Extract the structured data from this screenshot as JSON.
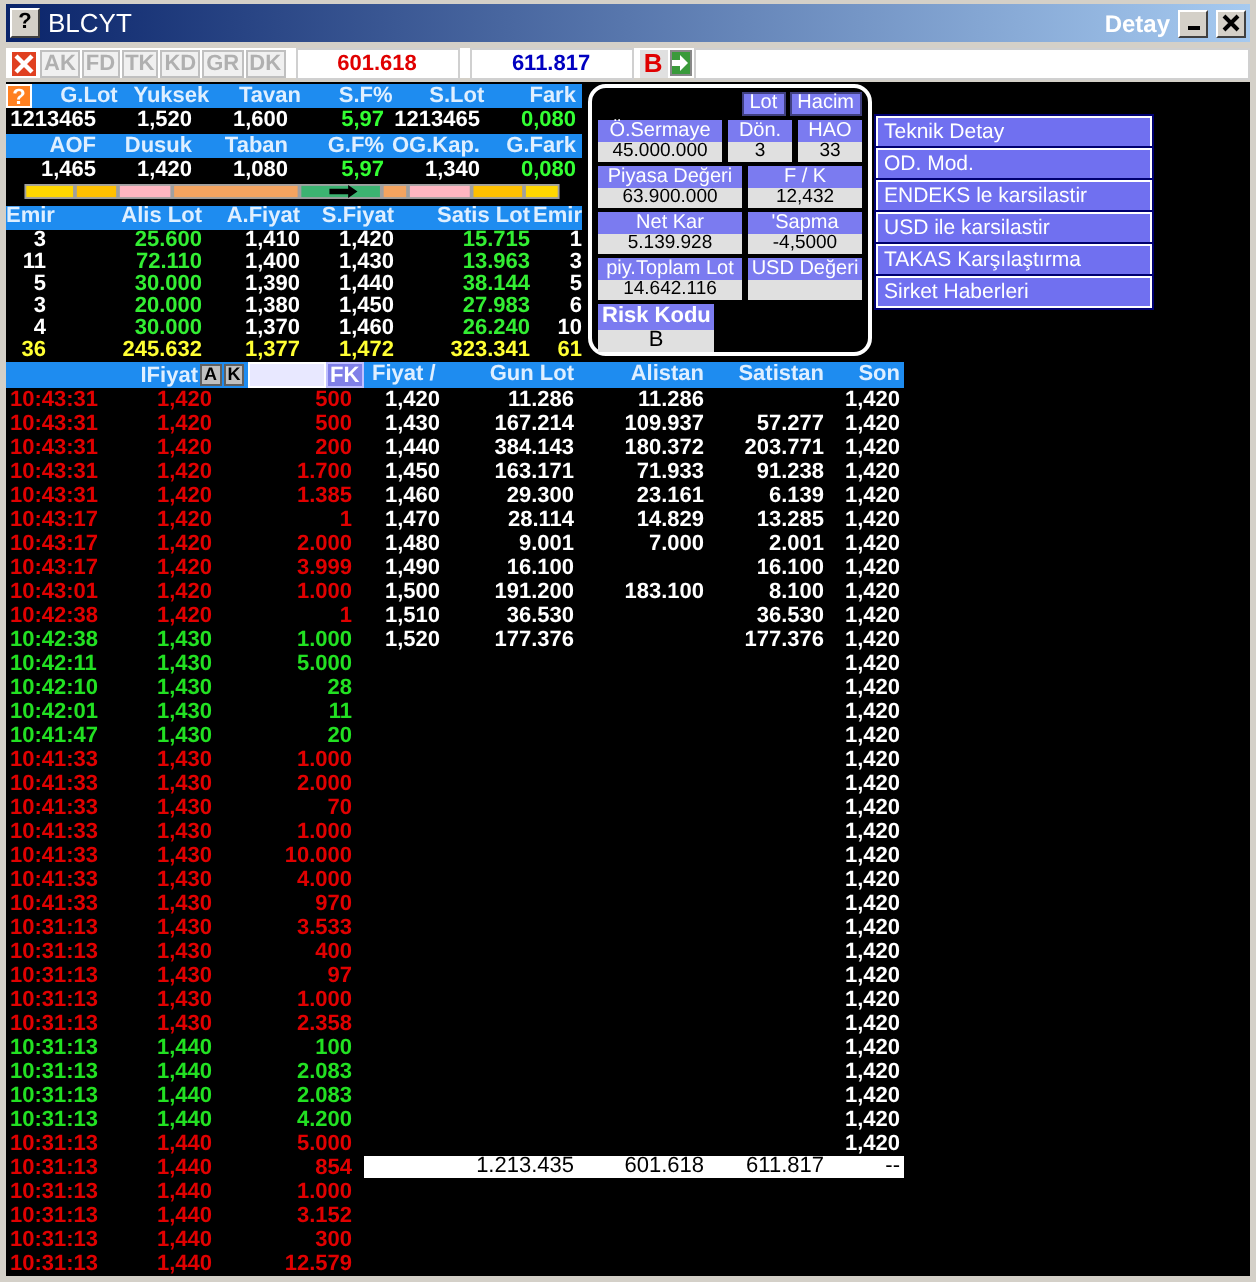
{
  "window": {
    "help": "?",
    "title": "BLCYT",
    "subtitle": "Detay"
  },
  "summary_help": "?",
  "toolbar": {
    "tabs": [
      {
        "label": "AK",
        "disabled": true
      },
      {
        "label": "FD",
        "disabled": true
      },
      {
        "label": "TK",
        "disabled": true
      },
      {
        "label": "KD",
        "disabled": true
      },
      {
        "label": "GR",
        "disabled": true
      },
      {
        "label": "DK",
        "disabled": true
      }
    ],
    "values": [
      {
        "text": "601.618",
        "color": "#e00000"
      },
      {
        "text": "611.817",
        "color": "#0000c0"
      }
    ],
    "b_button": "B"
  },
  "summary": [
    {
      "labels": [
        "G.Lot",
        "Yuksek",
        "Tavan",
        "S.F%",
        "S.Lot",
        "Fark"
      ],
      "values": [
        {
          "text": "1213465",
          "kind": "plain"
        },
        {
          "text": "1,520",
          "kind": "plain"
        },
        {
          "text": "1,600",
          "kind": "plain"
        },
        {
          "text": "5,97",
          "kind": "change"
        },
        {
          "text": "1213465",
          "kind": "plain"
        },
        {
          "text": "0,080",
          "kind": "change"
        }
      ]
    },
    {
      "labels": [
        "AOF",
        "Dusuk",
        "Taban",
        "G.F%",
        "OG.Kap.",
        "G.Fark"
      ],
      "values": [
        {
          "text": "1,465",
          "kind": "plain"
        },
        {
          "text": "1,420",
          "kind": "plain"
        },
        {
          "text": "1,080",
          "kind": "plain"
        },
        {
          "text": "5,97",
          "kind": "change"
        },
        {
          "text": "1,340",
          "kind": "plain"
        },
        {
          "text": "0,080",
          "kind": "change"
        }
      ]
    }
  ],
  "order_book": {
    "columns": [
      "Emir",
      "Alis Lot",
      "A.Fiyat",
      "S.Fiyat",
      "Satis Lot",
      "Emir"
    ],
    "rows": [
      {
        "kind": "level",
        "cells": [
          "3",
          "25.600",
          "1,410",
          "1,420",
          "15.715",
          "1"
        ]
      },
      {
        "kind": "level",
        "cells": [
          "11",
          "72.110",
          "1,400",
          "1,430",
          "13.963",
          "3"
        ]
      },
      {
        "kind": "level",
        "cells": [
          "5",
          "30.000",
          "1,390",
          "1,440",
          "38.144",
          "5"
        ]
      },
      {
        "kind": "level",
        "cells": [
          "3",
          "20.000",
          "1,380",
          "1,450",
          "27.983",
          "6"
        ]
      },
      {
        "kind": "level",
        "cells": [
          "4",
          "30.000",
          "1,370",
          "1,460",
          "26.240",
          "10"
        ]
      },
      {
        "kind": "total",
        "cells": [
          "36",
          "245.632",
          "1,377",
          "1,472",
          "323.341",
          "61"
        ]
      }
    ]
  },
  "info": {
    "buttons": [
      "Lot",
      "Hacim"
    ],
    "rows": [
      [
        {
          "label": "Ö.Sermaye",
          "value": "45.000.000"
        },
        {
          "label": "Dön.",
          "value": "3"
        },
        {
          "label": "HAO",
          "value": "33"
        }
      ],
      [
        {
          "label": "Piyasa Değeri",
          "value": "63.900.000"
        },
        {
          "label": "F / K",
          "value": "12,432"
        }
      ],
      [
        {
          "label": "Net Kar",
          "value": "5.139.928"
        },
        {
          "label": "'Sapma",
          "value": "-4,5000"
        }
      ],
      [
        {
          "label": "piy.Toplam Lot",
          "value": "14.642.116"
        },
        {
          "label": "USD Değeri"
        }
      ]
    ],
    "risk": {
      "label": "Risk Kodu",
      "value": "B"
    }
  },
  "menu": [
    "Teknik Detay",
    "OD. Mod.",
    "ENDEKS le karsilastir",
    "USD ile karsilastir",
    "TAKAS Karşılaştırma",
    "Sirket Haberleri"
  ],
  "trades": {
    "header": "IFiyat",
    "buttons": [
      "A",
      "K"
    ],
    "filter_button": "FK",
    "rows": [
      {
        "time": "10:43:31",
        "price": "1,420",
        "lot": "500",
        "kind": "sell"
      },
      {
        "time": "10:43:31",
        "price": "1,420",
        "lot": "500",
        "kind": "sell"
      },
      {
        "time": "10:43:31",
        "price": "1,420",
        "lot": "200",
        "kind": "sell"
      },
      {
        "time": "10:43:31",
        "price": "1,420",
        "lot": "1.700",
        "kind": "sell"
      },
      {
        "time": "10:43:31",
        "price": "1,420",
        "lot": "1.385",
        "kind": "sell"
      },
      {
        "time": "10:43:17",
        "price": "1,420",
        "lot": "1",
        "kind": "sell"
      },
      {
        "time": "10:43:17",
        "price": "1,420",
        "lot": "2.000",
        "kind": "sell"
      },
      {
        "time": "10:43:17",
        "price": "1,420",
        "lot": "3.999",
        "kind": "sell"
      },
      {
        "time": "10:43:01",
        "price": "1,420",
        "lot": "1.000",
        "kind": "sell"
      },
      {
        "time": "10:42:38",
        "price": "1,420",
        "lot": "1",
        "kind": "sell"
      },
      {
        "time": "10:42:38",
        "price": "1,430",
        "lot": "1.000",
        "kind": "buy"
      },
      {
        "time": "10:42:11",
        "price": "1,430",
        "lot": "5.000",
        "kind": "buy"
      },
      {
        "time": "10:42:10",
        "price": "1,430",
        "lot": "28",
        "kind": "buy"
      },
      {
        "time": "10:42:01",
        "price": "1,430",
        "lot": "11",
        "kind": "buy"
      },
      {
        "time": "10:41:47",
        "price": "1,430",
        "lot": "20",
        "kind": "buy"
      },
      {
        "time": "10:41:33",
        "price": "1,430",
        "lot": "1.000",
        "kind": "sell"
      },
      {
        "time": "10:41:33",
        "price": "1,430",
        "lot": "2.000",
        "kind": "sell"
      },
      {
        "time": "10:41:33",
        "price": "1,430",
        "lot": "70",
        "kind": "sell"
      },
      {
        "time": "10:41:33",
        "price": "1,430",
        "lot": "1.000",
        "kind": "sell"
      },
      {
        "time": "10:41:33",
        "price": "1,430",
        "lot": "10.000",
        "kind": "sell"
      },
      {
        "time": "10:41:33",
        "price": "1,430",
        "lot": "4.000",
        "kind": "sell"
      },
      {
        "time": "10:41:33",
        "price": "1,430",
        "lot": "970",
        "kind": "sell"
      },
      {
        "time": "10:31:13",
        "price": "1,430",
        "lot": "3.533",
        "kind": "sell"
      },
      {
        "time": "10:31:13",
        "price": "1,430",
        "lot": "400",
        "kind": "sell"
      },
      {
        "time": "10:31:13",
        "price": "1,430",
        "lot": "97",
        "kind": "sell"
      },
      {
        "time": "10:31:13",
        "price": "1,430",
        "lot": "1.000",
        "kind": "sell"
      },
      {
        "time": "10:31:13",
        "price": "1,430",
        "lot": "2.358",
        "kind": "sell"
      },
      {
        "time": "10:31:13",
        "price": "1,440",
        "lot": "100",
        "kind": "buy"
      },
      {
        "time": "10:31:13",
        "price": "1,440",
        "lot": "2.083",
        "kind": "buy"
      },
      {
        "time": "10:31:13",
        "price": "1,440",
        "lot": "2.083",
        "kind": "buy"
      },
      {
        "time": "10:31:13",
        "price": "1,440",
        "lot": "4.200",
        "kind": "buy"
      },
      {
        "time": "10:31:13",
        "price": "1,440",
        "lot": "5.000",
        "kind": "sell"
      },
      {
        "time": "10:31:13",
        "price": "1,440",
        "lot": "854",
        "kind": "sell"
      },
      {
        "time": "10:31:13",
        "price": "1,440",
        "lot": "1.000",
        "kind": "sell"
      },
      {
        "time": "10:31:13",
        "price": "1,440",
        "lot": "3.152",
        "kind": "sell"
      },
      {
        "time": "10:31:13",
        "price": "1,440",
        "lot": "300",
        "kind": "sell"
      },
      {
        "time": "10:31:13",
        "price": "1,440",
        "lot": "12.579",
        "kind": "sell"
      }
    ]
  },
  "price_table": {
    "columns": [
      "Fiyat /",
      "Gun Lot",
      "Alistan",
      "Satistan",
      "Son"
    ],
    "rows": [
      {
        "fiyat": "1,420",
        "gun_lot": "11.286",
        "alistan": "11.286",
        "son": "1,420"
      },
      {
        "fiyat": "1,430",
        "gun_lot": "167.214",
        "alistan": "109.937",
        "satistan": "57.277",
        "son": "1,420"
      },
      {
        "fiyat": "1,440",
        "gun_lot": "384.143",
        "alistan": "180.372",
        "satistan": "203.771",
        "son": "1,420"
      },
      {
        "fiyat": "1,450",
        "gun_lot": "163.171",
        "alistan": "71.933",
        "satistan": "91.238",
        "son": "1,420"
      },
      {
        "fiyat": "1,460",
        "gun_lot": "29.300",
        "alistan": "23.161",
        "satistan": "6.139",
        "son": "1,420"
      },
      {
        "fiyat": "1,470",
        "gun_lot": "28.114",
        "alistan": "14.829",
        "satistan": "13.285",
        "son": "1,420"
      },
      {
        "fiyat": "1,480",
        "gun_lot": "9.001",
        "alistan": "7.000",
        "satistan": "2.001",
        "son": "1,420"
      },
      {
        "fiyat": "1,490",
        "gun_lot": "16.100",
        "satistan": "16.100",
        "son": "1,420"
      },
      {
        "fiyat": "1,500",
        "gun_lot": "191.200",
        "alistan": "183.100",
        "satistan": "8.100",
        "son": "1,420"
      },
      {
        "fiyat": "1,510",
        "gun_lot": "36.530",
        "satistan": "36.530",
        "son": "1,420"
      },
      {
        "fiyat": "1,520",
        "gun_lot": "177.376",
        "satistan": "177.376",
        "son": "1,420"
      },
      {
        "son": "1,420"
      },
      {
        "son": "1,420"
      },
      {
        "son": "1,420"
      },
      {
        "son": "1,420"
      },
      {
        "son": "1,420"
      },
      {
        "son": "1,420"
      },
      {
        "son": "1,420"
      },
      {
        "son": "1,420"
      },
      {
        "son": "1,420"
      },
      {
        "son": "1,420"
      },
      {
        "son": "1,420"
      },
      {
        "son": "1,420"
      },
      {
        "son": "1,420"
      },
      {
        "son": "1,420"
      },
      {
        "son": "1,420"
      },
      {
        "son": "1,420"
      },
      {
        "son": "1,420"
      },
      {
        "son": "1,420"
      },
      {
        "son": "1,420"
      },
      {
        "son": "1,420"
      },
      {
        "son": "1,420"
      }
    ],
    "totals": {
      "gun_lot": "1.213.435",
      "alistan": "601.618",
      "satistan": "611.817",
      "son": "--"
    }
  }
}
